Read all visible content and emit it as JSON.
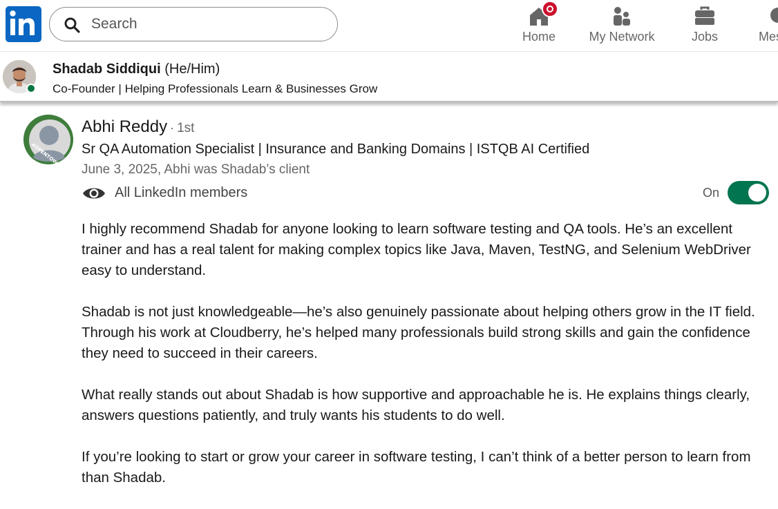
{
  "nav": {
    "search_placeholder": "Search",
    "items": [
      {
        "label": "Home",
        "icon": "home-icon"
      },
      {
        "label": "My Network",
        "icon": "my-network-icon"
      },
      {
        "label": "Jobs",
        "icon": "jobs-icon"
      },
      {
        "label": "Mes",
        "icon": "messaging-icon"
      }
    ]
  },
  "profile": {
    "name": "Shadab Siddiqui",
    "pronouns": "(He/Him)",
    "headline": "Co-Founder | Helping Professionals Learn & Businesses Grow",
    "online": true
  },
  "recommendation": {
    "name": "Abhi Reddy",
    "separator": "·",
    "degree": "1st",
    "headline": "Sr QA Automation Specialist | Insurance and Banking Domains | ISTQB AI Certified",
    "meta": "June 3, 2025, Abhi was Shadab’s client",
    "visibility_label": "All LinkedIn members",
    "toggle_label": "On",
    "toggle_on": true,
    "paragraphs": [
      "I highly recommend Shadab for anyone looking to learn software testing and QA tools. He’s an excellent trainer and has a real talent for making complex topics like Java, Maven, TestNG, and Selenium WebDriver easy to understand.",
      "Shadab is not just knowledgeable—he’s also genuinely passionate about helping others grow in the IT field. Through his work at Cloudberry, he’s helped many professionals build strong skills and gain the confidence they need to succeed in their careers.",
      "What really stands out about Shadab is how supportive and approachable he is. He explains things clearly, answers questions patiently, and truly wants his students to do well.",
      "If you’re looking to start or grow your career in software testing, I can’t think of a better person to learn from than Shadab."
    ]
  },
  "colors": {
    "brand": "#0a66c2",
    "toggle_on": "#01754f",
    "notification": "#cb112d",
    "online": "#057642"
  }
}
